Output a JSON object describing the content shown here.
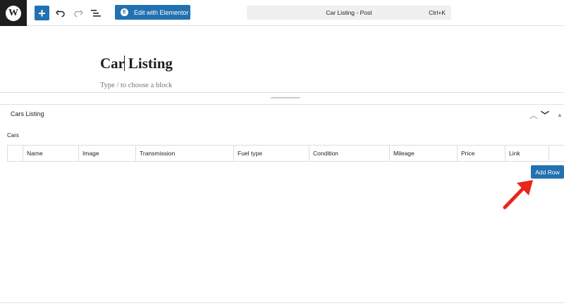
{
  "toolbar": {
    "logo_glyph": "W",
    "add_block_glyph": "+",
    "edit_elementor_label": "Edit with Elementor",
    "elementor_icon_glyph": "E",
    "command_title": "Car Listing - Post",
    "command_shortcut": "Ctrl+K",
    "icons": [
      "wordpress-logo",
      "plus-icon",
      "undo-icon",
      "redo-icon",
      "document-overview-icon",
      "elementor-icon"
    ]
  },
  "editor": {
    "post_title": "Car Listing",
    "block_placeholder": "Type / to choose a block"
  },
  "metabox": {
    "title": "Cars Listing",
    "move_up_glyph": "︿",
    "move_down_glyph": "﹀",
    "toggle_glyph": "▲",
    "field_label": "Cars",
    "columns": [
      "",
      "Name",
      "Image",
      "Transmission",
      "Fuel type",
      "Condition",
      "Mileage",
      "Price",
      "Link",
      ""
    ],
    "add_row_label": "Add Row"
  },
  "colors": {
    "accent": "#2271b1",
    "annotation_arrow": "#e8261b",
    "logo_bg": "#1e1e1e"
  }
}
